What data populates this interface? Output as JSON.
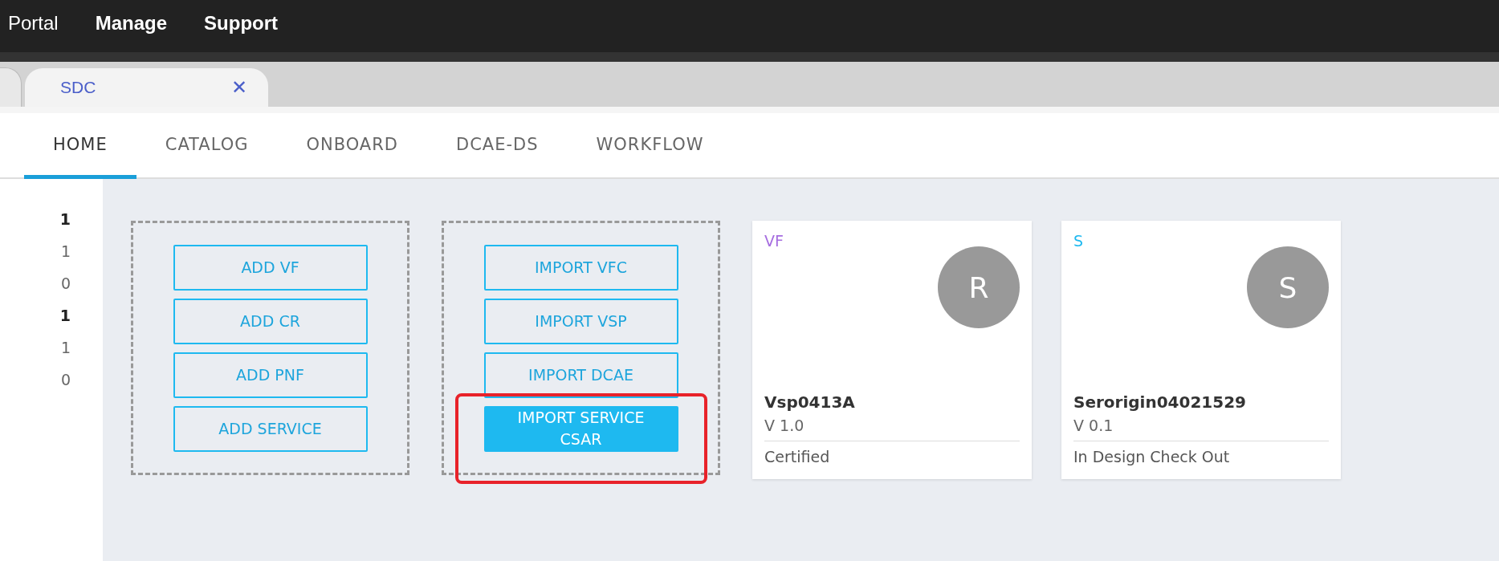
{
  "top_menu": [
    "Portal",
    "Manage",
    "Support"
  ],
  "browser_tabs": [
    {
      "label": "SDC",
      "close": "✕",
      "selected": true
    }
  ],
  "nav_tabs": [
    {
      "label": "HOME",
      "selected": true
    },
    {
      "label": "CATALOG",
      "selected": false
    },
    {
      "label": "ONBOARD",
      "selected": false
    },
    {
      "label": "DCAE-DS",
      "selected": false
    },
    {
      "label": "WORKFLOW",
      "selected": false
    }
  ],
  "sidebar": {
    "digits": [
      {
        "text": "1",
        "bold": true
      },
      {
        "text": "1",
        "bold": false
      },
      {
        "text": "0",
        "bold": false
      },
      {
        "text": "1",
        "bold": true
      },
      {
        "text": "1",
        "bold": false
      },
      {
        "text": "0",
        "bold": false
      }
    ]
  },
  "action_groups": [
    {
      "buttons": [
        {
          "lines": [
            "ADD VF"
          ],
          "filled": false,
          "highlighted": false
        },
        {
          "lines": [
            "ADD CR"
          ],
          "filled": false,
          "highlighted": false
        },
        {
          "lines": [
            "ADD PNF"
          ],
          "filled": false,
          "highlighted": false
        },
        {
          "lines": [
            "ADD SERVICE"
          ],
          "filled": false,
          "highlighted": false
        }
      ]
    },
    {
      "buttons": [
        {
          "lines": [
            "IMPORT VFC"
          ],
          "filled": false,
          "highlighted": false
        },
        {
          "lines": [
            "IMPORT VSP"
          ],
          "filled": false,
          "highlighted": false
        },
        {
          "lines": [
            "IMPORT DCAE"
          ],
          "filled": false,
          "highlighted": false
        },
        {
          "lines": [
            "IMPORT SERVICE",
            "CSAR"
          ],
          "filled": true,
          "highlighted": true
        }
      ]
    }
  ],
  "cards": [
    {
      "type": "VF",
      "color": "#a66de0",
      "avatar": "R",
      "name": "Vsp0413A",
      "version": "V 1.0",
      "status": "Certified"
    },
    {
      "type": "S",
      "color": "#1eb9f0",
      "avatar": "S",
      "name": "Serorigin04021529",
      "version": "V 0.1",
      "status": "In Design Check Out"
    }
  ]
}
